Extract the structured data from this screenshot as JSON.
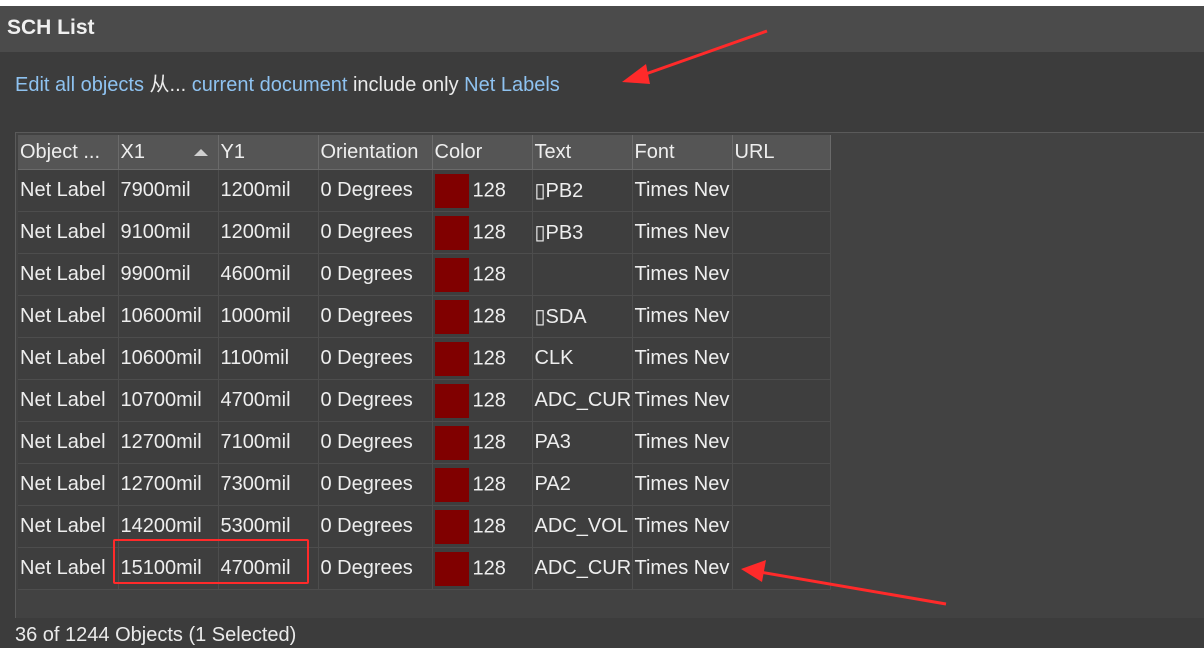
{
  "window": {
    "title": "SCH List"
  },
  "filter": {
    "edit_label": "Edit all objects",
    "from_label": "从...",
    "scope_label": "current document",
    "include_label": "include only",
    "type_label": "Net Labels"
  },
  "table": {
    "headers": [
      "Object ...",
      "X1",
      "Y1",
      "Orientation",
      "Color",
      "Text",
      "Font",
      "URL"
    ],
    "sort_column": "X1",
    "rows": [
      {
        "object": "Net Label",
        "x1": "7900mil",
        "y1": "1200mil",
        "orientation": "0 Degrees",
        "color": "128",
        "color_hex": "#800000",
        "text": "▯PB2",
        "font": "Times Nev",
        "url": ""
      },
      {
        "object": "Net Label",
        "x1": "9100mil",
        "y1": "1200mil",
        "orientation": "0 Degrees",
        "color": "128",
        "color_hex": "#800000",
        "text": "▯PB3",
        "font": "Times Nev",
        "url": ""
      },
      {
        "object": "Net Label",
        "x1": "9900mil",
        "y1": "4600mil",
        "orientation": "0 Degrees",
        "color": "128",
        "color_hex": "#800000",
        "text": "",
        "font": "Times Nev",
        "url": ""
      },
      {
        "object": "Net Label",
        "x1": "10600mil",
        "y1": "1000mil",
        "orientation": "0 Degrees",
        "color": "128",
        "color_hex": "#800000",
        "text": "▯SDA",
        "font": "Times Nev",
        "url": ""
      },
      {
        "object": "Net Label",
        "x1": "10600mil",
        "y1": "1100mil",
        "orientation": "0 Degrees",
        "color": "128",
        "color_hex": "#800000",
        "text": "CLK",
        "font": "Times Nev",
        "url": ""
      },
      {
        "object": "Net Label",
        "x1": "10700mil",
        "y1": "4700mil",
        "orientation": "0 Degrees",
        "color": "128",
        "color_hex": "#800000",
        "text": "ADC_CUR",
        "font": "Times Nev",
        "url": ""
      },
      {
        "object": "Net Label",
        "x1": "12700mil",
        "y1": "7100mil",
        "orientation": "0 Degrees",
        "color": "128",
        "color_hex": "#800000",
        "text": "PA3",
        "font": "Times Nev",
        "url": ""
      },
      {
        "object": "Net Label",
        "x1": "12700mil",
        "y1": "7300mil",
        "orientation": "0 Degrees",
        "color": "128",
        "color_hex": "#800000",
        "text": "PA2",
        "font": "Times Nev",
        "url": ""
      },
      {
        "object": "Net Label",
        "x1": "14200mil",
        "y1": "5300mil",
        "orientation": "0 Degrees",
        "color": "128",
        "color_hex": "#800000",
        "text": "ADC_VOL",
        "font": "Times Nev",
        "url": ""
      },
      {
        "object": "Net Label",
        "x1": "15100mil",
        "y1": "4700mil",
        "orientation": "0 Degrees",
        "color": "128",
        "color_hex": "#800000",
        "text": "ADC_CUR",
        "font": "Times Nev",
        "url": ""
      }
    ]
  },
  "status": {
    "text": "36 of 1244 Objects (1 Selected)"
  },
  "colors": {
    "annotation": "#ff2a2a",
    "link": "#8ec2f0",
    "swatch": "#800000"
  }
}
